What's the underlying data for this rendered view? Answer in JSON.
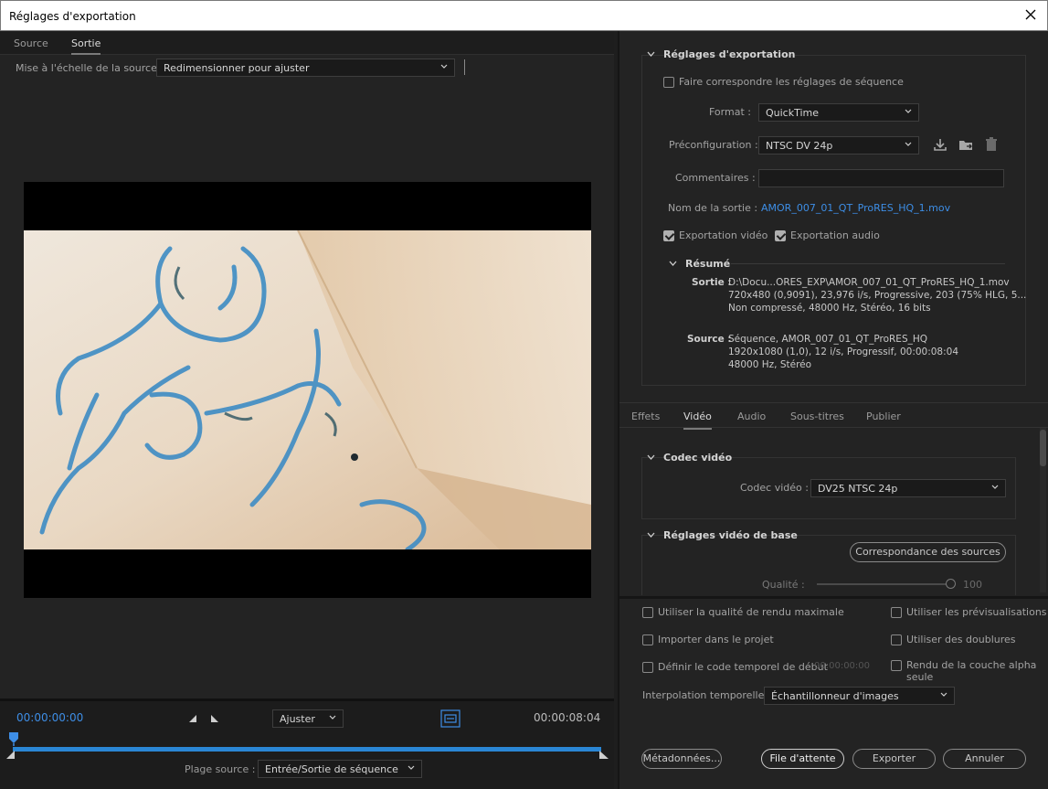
{
  "window": {
    "title": "Réglages d'exportation"
  },
  "left": {
    "tabs": [
      "Source",
      "Sortie"
    ],
    "active_tab": "Sortie",
    "scale_label": "Mise à l'échelle de la source :",
    "scale_value": "Redimensionner pour ajuster",
    "timecode_start": "00:00:00:00",
    "timecode_end": "00:00:08:04",
    "fit_value": "Ajuster",
    "source_range_label": "Plage source :",
    "source_range_value": "Entrée/Sortie de séquence"
  },
  "export": {
    "section_title": "Réglages d'exportation",
    "match_sequence_label": "Faire correspondre les réglages de séquence",
    "match_sequence_checked": false,
    "format_label": "Format :",
    "format_value": "QuickTime",
    "preset_label": "Préconfiguration :",
    "preset_value": "NTSC DV 24p",
    "comments_label": "Commentaires :",
    "comments_value": "",
    "output_name_label": "Nom de la sortie :",
    "output_name_value": "AMOR_007_01_QT_ProRES_HQ_1.mov",
    "video_export_label": "Exportation vidéo",
    "video_export_checked": true,
    "audio_export_label": "Exportation audio",
    "audio_export_checked": true
  },
  "summary": {
    "title": "Résumé",
    "output_key": "Sortie :",
    "output_lines": [
      "D:\\Docu...ORES_EXP\\AMOR_007_01_QT_ProRES_HQ_1.mov",
      "720x480 (0,9091), 23,976 i/s, Progressive, 203 (75% HLG, 5...",
      "Non compressé, 48000  Hz, Stéréo, 16 bits"
    ],
    "source_key": "Source :",
    "source_lines": [
      "Séquence, AMOR_007_01_QT_ProRES_HQ",
      "1920x1080 (1,0), 12  i/s, Progressif, 00:00:08:04",
      "48000 Hz, Stéréo"
    ]
  },
  "right_tabs": [
    "Effets",
    "Vidéo",
    "Audio",
    "Sous-titres",
    "Publier"
  ],
  "active_right_tab": "Vidéo",
  "codec": {
    "section_title": "Codec vidéo",
    "label": "Codec vidéo :",
    "value": "DV25 NTSC 24p"
  },
  "basic_video": {
    "section_title": "Réglages vidéo de base",
    "match_source_button": "Correspondance des sources",
    "quality_label": "Qualité :",
    "quality_value": "100"
  },
  "bottom": {
    "max_render_quality": "Utiliser la qualité de rendu maximale",
    "use_previews": "Utiliser les prévisualisations",
    "import_into_project": "Importer dans le projet",
    "use_proxies": "Utiliser des doublures",
    "set_start_timecode": "Définir le code temporel de début",
    "start_timecode_value": "00:00:00:00",
    "render_alpha_only": "Rendu de la couche alpha seule",
    "time_interpolation_label": "Interpolation temporelle :",
    "time_interpolation_value": "Échantillonneur d'images"
  },
  "buttons": {
    "metadata": "Métadonnées...",
    "queue": "File d'attente",
    "export": "Exporter",
    "cancel": "Annuler"
  },
  "colors": {
    "accent_blue": "#3e8ee6",
    "panel_bg": "#232323",
    "titlebar_bg": "#ffffff"
  }
}
